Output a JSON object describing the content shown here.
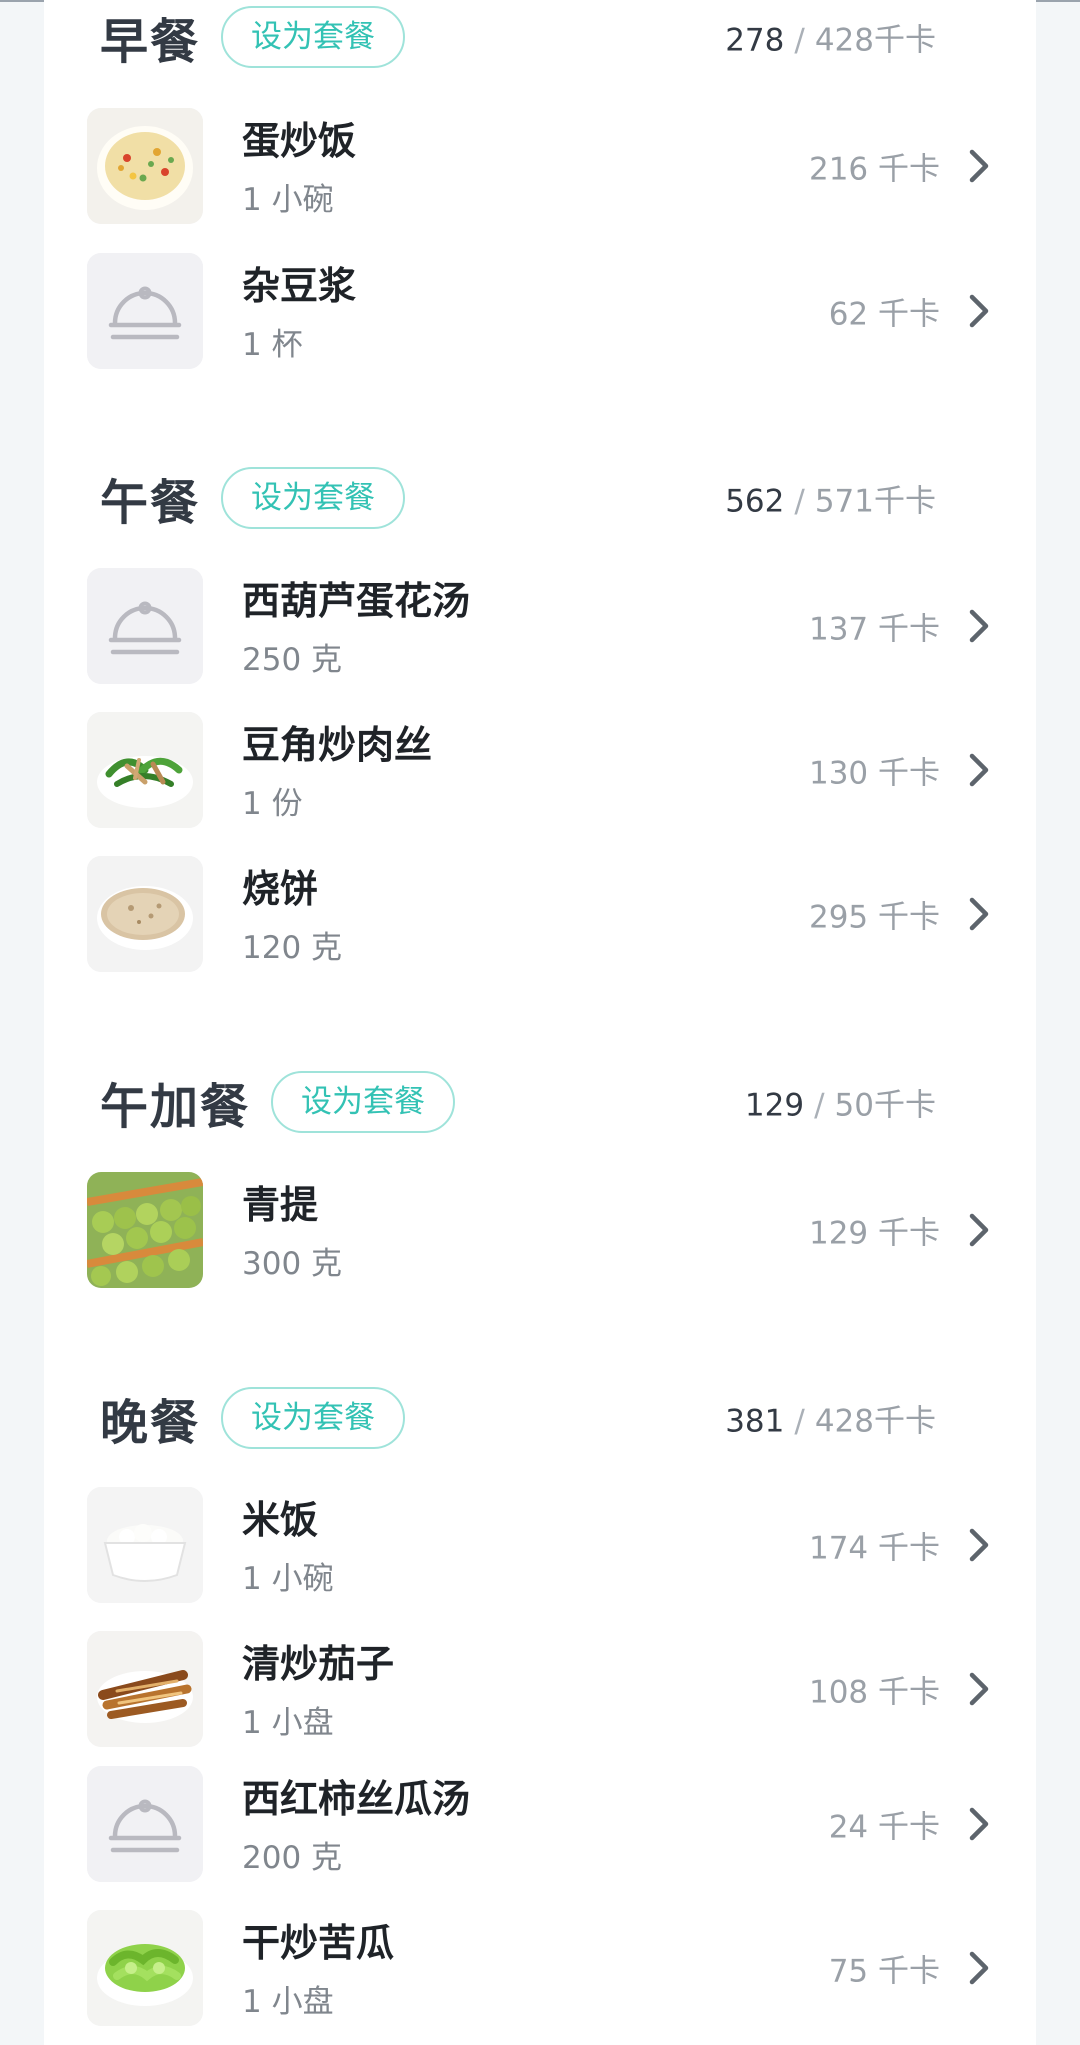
{
  "set_meal_label": "设为套餐",
  "unit": "千卡",
  "meals": [
    {
      "title": "早餐",
      "eaten": "278",
      "target": "428千卡",
      "items": [
        {
          "name": "蛋炒饭",
          "amount": "1 小碗",
          "kcal": "216 千卡",
          "icon": "fried-rice-icon"
        },
        {
          "name": "杂豆浆",
          "amount": "1 杯",
          "kcal": "62 千卡",
          "icon": "food-cloche-icon"
        }
      ]
    },
    {
      "title": "午餐",
      "eaten": "562",
      "target": "571千卡",
      "items": [
        {
          "name": "西葫芦蛋花汤",
          "amount": "250 克",
          "kcal": "137 千卡",
          "icon": "food-cloche-icon"
        },
        {
          "name": "豆角炒肉丝",
          "amount": "1 份",
          "kcal": "130 千卡",
          "icon": "green-beans-pork-icon"
        },
        {
          "name": "烧饼",
          "amount": "120 克",
          "kcal": "295 千卡",
          "icon": "flatbread-icon"
        }
      ]
    },
    {
      "title": "午加餐",
      "eaten": "129",
      "target": "50千卡",
      "items": [
        {
          "name": "青提",
          "amount": "300 克",
          "kcal": "129 千卡",
          "icon": "green-grapes-icon"
        }
      ]
    },
    {
      "title": "晚餐",
      "eaten": "381",
      "target": "428千卡",
      "items": [
        {
          "name": "米饭",
          "amount": "1 小碗",
          "kcal": "174 千卡",
          "icon": "rice-bowl-icon"
        },
        {
          "name": "清炒茄子",
          "amount": "1 小盘",
          "kcal": "108 千卡",
          "icon": "eggplant-dish-icon"
        },
        {
          "name": "西红柿丝瓜汤",
          "amount": "200 克",
          "kcal": "24 千卡",
          "icon": "food-cloche-icon"
        },
        {
          "name": "干炒苦瓜",
          "amount": "1 小盘",
          "kcal": "75 千卡",
          "icon": "bitter-melon-icon"
        }
      ]
    }
  ]
}
